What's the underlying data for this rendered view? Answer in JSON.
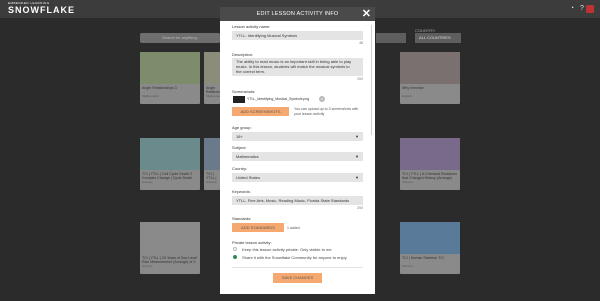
{
  "app": {
    "logo_prefix": "EMBEDDED LEARNING",
    "logo": "SNOWFLAKE"
  },
  "background": {
    "search_placeholder": "Search for anything...",
    "country_label": "COUNTRY:",
    "country_value": "ALL COUNTRIES",
    "cards": [
      {
        "title": "Angle Relationships 3",
        "subject": "Mathematics"
      },
      {
        "title": "Angle Relationship",
        "subject": "Mathematics"
      },
      {
        "title": "Why exercise",
        "subject": "English"
      },
      {
        "title": "TCI | YTLL | Cell Cycle Death 3 Complex Change | Cycle Death",
        "subject": "Science"
      },
      {
        "title": "TCI | YTLL | ...",
        "subject": "Science"
      },
      {
        "title": "TCI | YTLL | A Chemical Reactions that Changed History (Arrange)",
        "subject": "Science"
      },
      {
        "title": "TCI | YTLL | 20 Years of Sea Level Rise Measurement (Arrange) of 3",
        "subject": "Science"
      },
      {
        "title": "TCI | Human Skeleton TCI",
        "subject": "Science"
      }
    ]
  },
  "modal": {
    "title": "EDIT LESSON ACTIVITY INFO",
    "close": "✕",
    "name_label": "Lesson activity name:",
    "name_value": "YTLL: Identifying Musical Symbols",
    "name_count": "48",
    "description_label": "Description:",
    "description_value": "The ability to read music is an important skill in being able to play music. In this lesson, students will match the musical symbols to the correct term.",
    "description_count": "200",
    "screenshots_label": "Screenshots:",
    "screenshot_file": "YTLL_Identifying_Musical_Symbols.png",
    "add_screenshots": "ADD SCREENSHOTS",
    "screenshots_help": "You can upload up to 3 screenshots with your lesson activity",
    "age_label": "Age group:",
    "age_value": "18+",
    "subject_label": "Subject:",
    "subject_value": "Mathematics",
    "country_label": "Country:",
    "country_value": "United States",
    "keywords_label": "Keywords:",
    "keywords_value": "YTLL, Fine Arts, Music, Reading Music, Florida State Standards",
    "keywords_count": "200",
    "standards_label": "Standards:",
    "add_standards": "ADD STANDARDS",
    "standards_note": "1 added",
    "private_label": "Private lesson activity:",
    "private_option": "Keep this lesson activity private. Only visible to me",
    "share_option": "Share it with the Snowflake Community for anyone to enjoy",
    "save": "SAVE CHANGES"
  }
}
